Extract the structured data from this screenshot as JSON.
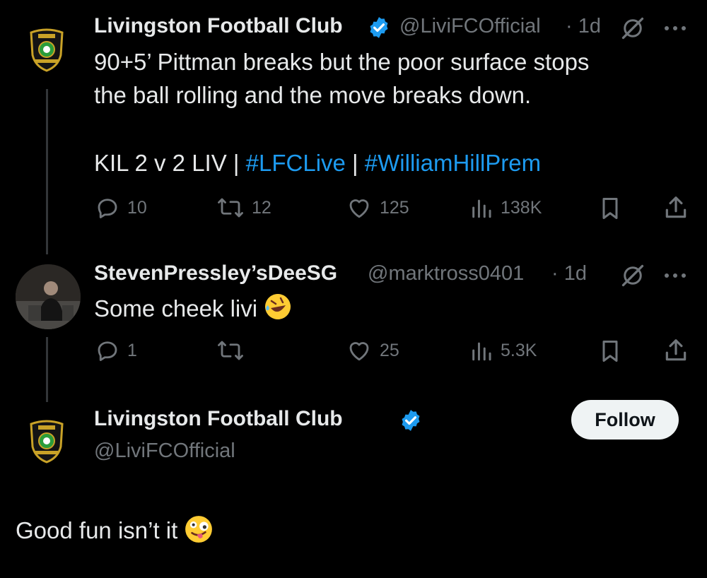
{
  "tweet1": {
    "name": "Livingston Football Club",
    "handle": "@LiviFCOfficial",
    "time": "· 1d",
    "line1": "90+5’ Pittman breaks but the poor surface stops",
    "line2": "the ball rolling and the move breaks down.",
    "score_prefix": "KIL 2 v 2 LIV | ",
    "hashtag1": "#LFCLive",
    "separator": " | ",
    "hashtag2": "#WilliamHillPrem",
    "replies": "10",
    "retweets": "12",
    "likes": "125",
    "views": "138K"
  },
  "tweet2": {
    "name": "StevenPressley’sDeeSG",
    "handle": "@marktross0401",
    "time": "· 1d",
    "text": "Some cheek livi",
    "emoji": "rolling-on-floor-laughing",
    "replies": "1",
    "retweets": "",
    "likes": "25",
    "views": "5.3K"
  },
  "tweet3": {
    "name": "Livingston Football Club",
    "handle": "@LiviFCOfficial",
    "follow_label": "Follow",
    "text": "Good fun isn’t it",
    "emoji": "zany-face"
  },
  "colors": {
    "background": "#000000",
    "text": "#e7e9ea",
    "muted": "#71767b",
    "accent": "#1d9bf0",
    "follow_bg": "#eff3f4"
  },
  "icons": [
    "verified-badge-icon",
    "grok-icon",
    "more-icon",
    "reply-icon",
    "retweet-icon",
    "like-icon",
    "views-icon",
    "bookmark-icon",
    "share-icon"
  ]
}
